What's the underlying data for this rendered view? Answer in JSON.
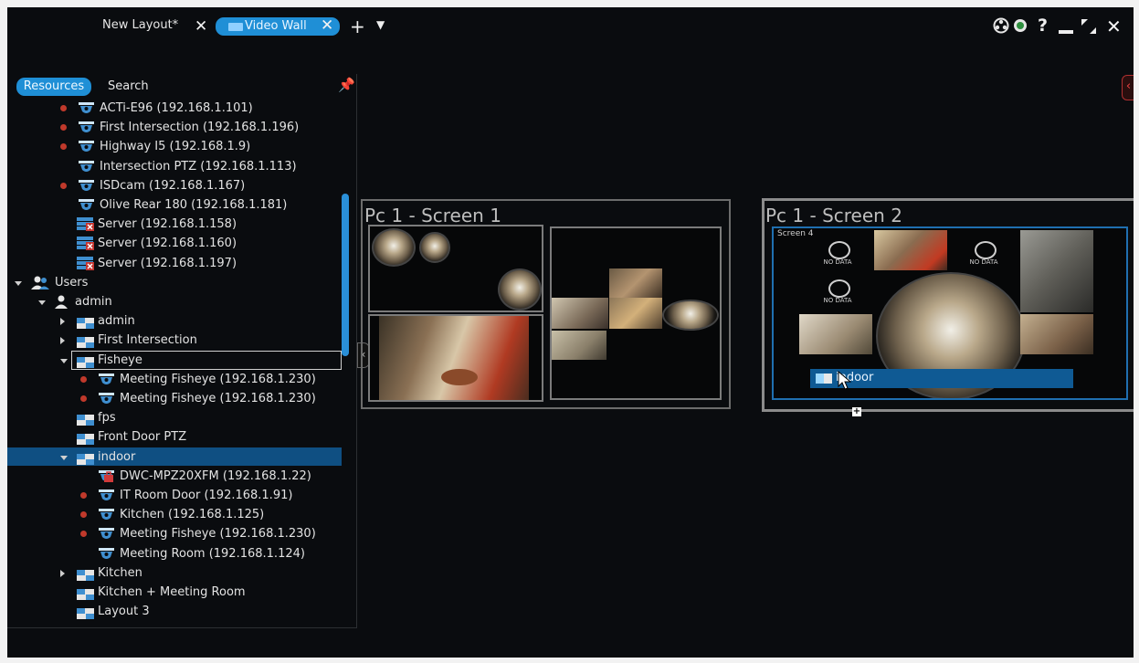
{
  "tabs": [
    {
      "label": "New Layout*",
      "active": false
    },
    {
      "label": "Video Wall",
      "active": true
    }
  ],
  "tabbar_icons": [
    "close-icon",
    "add-tab-icon",
    "tab-list-dropdown-icon"
  ],
  "window_controls": [
    "settings-icon",
    "notifications-icon",
    "help-icon",
    "minimize-icon",
    "fullscreen-icon",
    "close-icon"
  ],
  "panel": {
    "tabs": [
      {
        "label": "Resources",
        "active": true
      },
      {
        "label": "Search",
        "active": false
      }
    ],
    "pin_icon": "pin-icon",
    "tree": [
      {
        "label": "ACTi-E96 (192.168.1.101)",
        "icon": "camera-icon",
        "status_dot": true
      },
      {
        "label": "First Intersection (192.168.1.196)",
        "icon": "camera-icon",
        "status_dot": true
      },
      {
        "label": "Highway I5 (192.168.1.9)",
        "icon": "camera-icon",
        "status_dot": true
      },
      {
        "label": "Intersection PTZ (192.168.1.113)",
        "icon": "camera-icon",
        "status_dot": false
      },
      {
        "label": "ISDcam (192.168.1.167)",
        "icon": "camera-icon",
        "status_dot": true
      },
      {
        "label": "Olive Rear 180 (192.168.1.181)",
        "icon": "camera-icon",
        "status_dot": false
      },
      {
        "label": "Server (192.168.1.158)",
        "icon": "server-offline-icon",
        "status_dot": false
      },
      {
        "label": "Server (192.168.1.160)",
        "icon": "server-offline-icon",
        "status_dot": false
      },
      {
        "label": "Server (192.168.1.197)",
        "icon": "server-offline-icon",
        "status_dot": false
      },
      {
        "label": "Users",
        "icon": "users-icon",
        "expanded": true
      },
      {
        "label": "admin",
        "icon": "user-icon",
        "expanded": true
      },
      {
        "label": "admin",
        "icon": "layout-icon",
        "collapsed": true
      },
      {
        "label": "First Intersection",
        "icon": "layout-icon",
        "collapsed": true
      },
      {
        "label": "Fisheye",
        "icon": "layout-icon",
        "expanded": true,
        "outlined": true
      },
      {
        "label": "Meeting Fisheye (192.168.1.230)",
        "icon": "camera-icon",
        "status_dot": true
      },
      {
        "label": "Meeting Fisheye (192.168.1.230)",
        "icon": "camera-icon",
        "status_dot": true
      },
      {
        "label": "fps",
        "icon": "layout-icon"
      },
      {
        "label": "Front Door PTZ",
        "icon": "layout-icon"
      },
      {
        "label": "indoor",
        "icon": "layout-icon",
        "expanded": true,
        "selected": true
      },
      {
        "label": "DWC-MPZ20XFM (192.168.1.22)",
        "icon": "camera-locked-icon",
        "status_dot": false
      },
      {
        "label": "IT Room Door (192.168.1.91)",
        "icon": "camera-icon",
        "status_dot": true
      },
      {
        "label": "Kitchen (192.168.1.125)",
        "icon": "camera-icon",
        "status_dot": true
      },
      {
        "label": "Meeting Fisheye (192.168.1.230)",
        "icon": "camera-icon",
        "status_dot": true
      },
      {
        "label": "Meeting Room (192.168.1.124)",
        "icon": "camera-icon",
        "status_dot": false
      },
      {
        "label": "Kitchen",
        "icon": "layout-icon",
        "collapsed": true
      },
      {
        "label": "Kitchen + Meeting Room",
        "icon": "layout-icon"
      },
      {
        "label": "Layout 3",
        "icon": "layout-icon"
      }
    ]
  },
  "screens": [
    {
      "title": "Pc 1 - Screen 1"
    },
    {
      "title": "Pc 1 - Screen 2",
      "inner_label": "Screen 4",
      "no_data_label": "NO DATA",
      "drop_label": "indoor"
    }
  ],
  "colors": {
    "accent": "#1f8fd6",
    "background": "#0a0c0f",
    "status_dot": "#c0392b",
    "selection": "#0f4f82"
  }
}
